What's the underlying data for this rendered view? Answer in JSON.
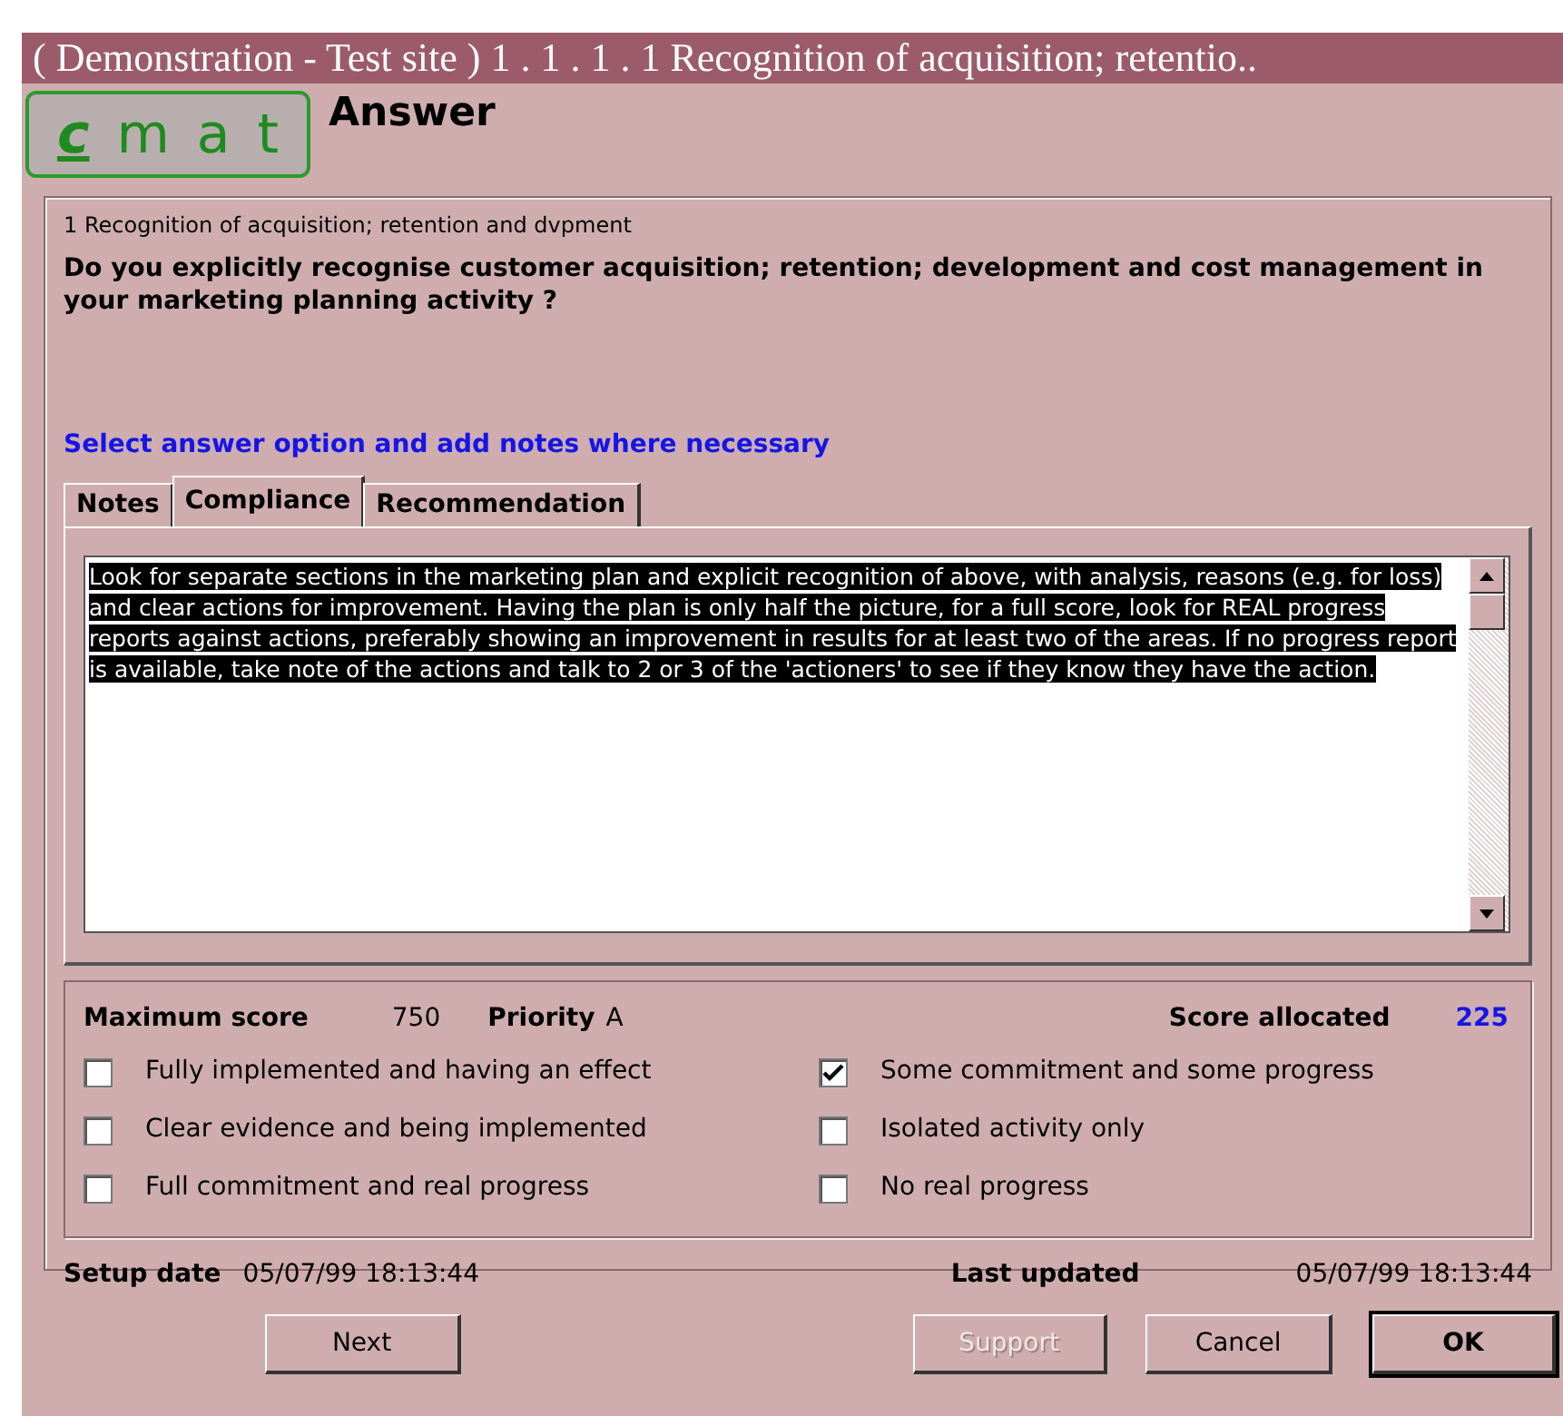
{
  "window": {
    "title": "( Demonstration - Test site )  1 . 1 . 1 . 1   Recognition of acquisition; retentio.."
  },
  "logo": {
    "letters": [
      "c",
      "m",
      "a",
      "t"
    ]
  },
  "heading": "Answer",
  "question": {
    "section": "1 Recognition of acquisition; retention and dvpment",
    "text": "Do you explicitly recognise customer acquisition; retention; development and cost management in your marketing planning activity ?",
    "instruction": "Select answer option and add notes where necessary"
  },
  "tabs": [
    {
      "label": "Notes",
      "selected": false
    },
    {
      "label": "Compliance",
      "selected": true
    },
    {
      "label": "Recommendation",
      "selected": false
    }
  ],
  "notes_text": "Look for separate sections in the marketing plan and explicit recognition of above, with analysis, reasons (e.g. for loss) and clear actions for improvement.  Having the plan is only half the picture, for a full score, look for REAL progress reports against actions, preferably showing an improvement in results for at least two of the areas.  If no progress report is available, take note of the actions and talk to 2 or 3 of the 'actioners' to see if they know they have the action.",
  "score": {
    "max_label": "Maximum score",
    "max_value": "750",
    "priority_label": "Priority",
    "priority_value": "A",
    "allocated_label": "Score allocated",
    "allocated_value": "225"
  },
  "options": [
    {
      "label": "Fully implemented and having an effect",
      "checked": false
    },
    {
      "label": "Some commitment and some progress",
      "checked": true
    },
    {
      "label": "Clear evidence and being implemented",
      "checked": false
    },
    {
      "label": "Isolated activity only",
      "checked": false
    },
    {
      "label": "Full commitment and real progress",
      "checked": false
    },
    {
      "label": "No real progress",
      "checked": false
    }
  ],
  "dates": {
    "setup_label": "Setup date",
    "setup_value": "05/07/99 18:13:44",
    "updated_label": "Last updated",
    "updated_value": "05/07/99 18:13:44"
  },
  "buttons": [
    {
      "label": "Next",
      "disabled": false,
      "default": false
    },
    {
      "label": "Support",
      "disabled": true,
      "default": false
    },
    {
      "label": "Cancel",
      "disabled": false,
      "default": false
    },
    {
      "label": "OK",
      "disabled": false,
      "default": true
    }
  ]
}
